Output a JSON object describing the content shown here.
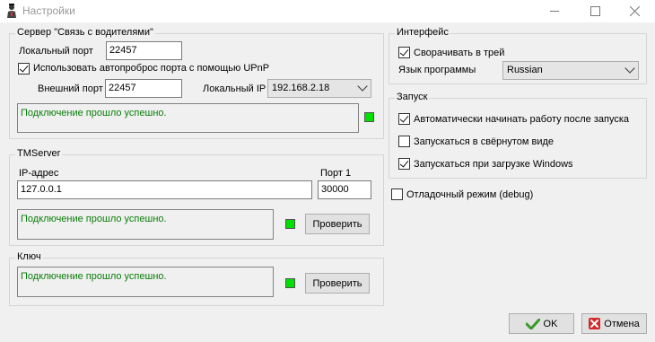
{
  "window": {
    "title": "Настройки"
  },
  "server_group": {
    "title": "Сервер \"Связь с водителями\"",
    "local_port_label": "Локальный порт",
    "local_port_value": "22457",
    "upnp_label": "Использовать автопроброс порта с помощью UPnP",
    "upnp_checked": true,
    "external_port_label": "Внешний порт",
    "external_port_value": "22457",
    "local_ip_label": "Локальный IP",
    "local_ip_value": "192.168.2.18",
    "status": "Подключение прошло успешно."
  },
  "tmserver_group": {
    "title": "TMServer",
    "ip_label": "IP-адрес",
    "ip_value": "127.0.0.1",
    "port_label": "Порт 1",
    "port_value": "30000",
    "status": "Подключение прошло успешно.",
    "check_label": "Проверить"
  },
  "key_group": {
    "title": "Ключ",
    "status": "Подключение прошло успешно.",
    "check_label": "Проверить"
  },
  "interface_group": {
    "title": "Интерфейс",
    "tray_label": "Сворачивать в трей",
    "tray_checked": true,
    "lang_label": "Язык программы",
    "lang_value": "Russian"
  },
  "startup_group": {
    "title": "Запуск",
    "autostart_label": "Автоматически начинать работу после запуска",
    "autostart_checked": true,
    "minimized_label": "Запускаться в свёрнутом виде",
    "minimized_checked": false,
    "windows_label": "Запускаться при загрузке Windows",
    "windows_checked": true
  },
  "debug": {
    "label": "Отладочный режим (debug)",
    "checked": false
  },
  "buttons": {
    "ok": "OK",
    "cancel": "Отмена"
  },
  "colors": {
    "status_text": "#0a7d0a",
    "led_ok": "#00e000"
  }
}
